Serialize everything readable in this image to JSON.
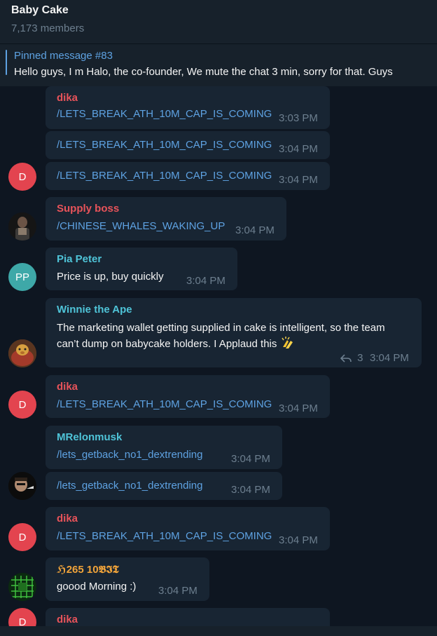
{
  "header": {
    "title": "Baby Cake",
    "members": "7,173 members"
  },
  "pinned": {
    "label": "Pinned message #83",
    "text": "Hello guys, I m Halo, the co-founder, We mute the chat 3 min, sorry for that.  Guys"
  },
  "messages": [
    {
      "sender": "dika",
      "text": "/LETS_BREAK_ATH_10M_CAP_IS_COMING",
      "time": "3:03 PM"
    },
    {
      "text": "/LETS_BREAK_ATH_10M_CAP_IS_COMING",
      "time": "3:04 PM"
    },
    {
      "text": "/LETS_BREAK_ATH_10M_CAP_IS_COMING",
      "time": "3:04 PM",
      "avatar": "D"
    },
    {
      "sender": "Supply boss",
      "text": "/CHINESE_WHALES_WAKING_UP",
      "time": "3:04 PM"
    },
    {
      "sender": "Pia Peter",
      "text": "Price is up, buy quickly",
      "time": "3:04 PM",
      "avatar": "PP"
    },
    {
      "sender": "Winnie the Ape",
      "text": "The marketing wallet getting supplied in cake is intelligent, so the team can’t dump on babycake holders. I Applaud this",
      "reply_count": "3",
      "time": "3:04 PM"
    },
    {
      "sender": "dika",
      "text": "/LETS_BREAK_ATH_10M_CAP_IS_COMING",
      "time": "3:04 PM",
      "avatar": "D"
    },
    {
      "sender": "MRelonmusk",
      "text": "/lets_getback_no1_dextrending",
      "time": "3:04 PM"
    },
    {
      "text": "/lets_getback_no1_dextrending",
      "time": "3:04 PM"
    },
    {
      "sender": "dika",
      "text": "/LETS_BREAK_ATH_10M_CAP_IS_COMING",
      "time": "3:04 PM",
      "avatar": "D"
    },
    {
      "sender": "ℌ265 10𝕭𝕴𝕿",
      "text": "goood Morning :)",
      "time": "3:04 PM"
    },
    {
      "sender": "dika",
      "avatar": "D"
    }
  ],
  "colors": {
    "background": "#0e1621",
    "bubble": "#182533",
    "header": "#17212b",
    "link": "#5ea2e2",
    "time": "#6d7f8f",
    "name_red": "#e8535a",
    "name_teal": "#4fc4d8",
    "name_orange": "#f0a33a",
    "avatar_red": "#e3444f",
    "avatar_teal": "#3ea8a8"
  }
}
